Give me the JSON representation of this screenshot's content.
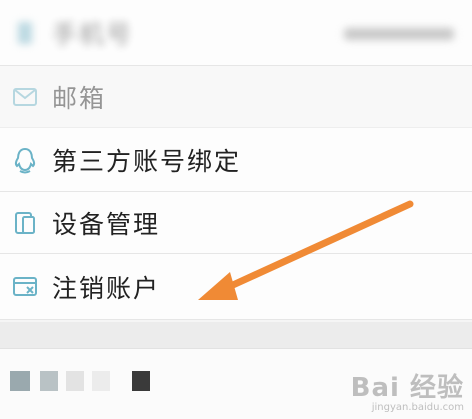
{
  "settings": {
    "items": [
      {
        "label": "手机号",
        "value": "",
        "icon": "phone-icon",
        "blurred": true
      },
      {
        "label": "邮箱",
        "icon": "mail-icon"
      },
      {
        "label": "第三方账号绑定",
        "icon": "qq-penguin-icon"
      },
      {
        "label": "设备管理",
        "icon": "device-icon"
      },
      {
        "label": "注销账户",
        "icon": "deregister-icon"
      }
    ]
  },
  "watermark": {
    "brand": "Bai 经验",
    "site": "jingyan.baidu.com"
  },
  "colors": {
    "arrow": "#f08a35",
    "icon": "#6bb3c7"
  }
}
